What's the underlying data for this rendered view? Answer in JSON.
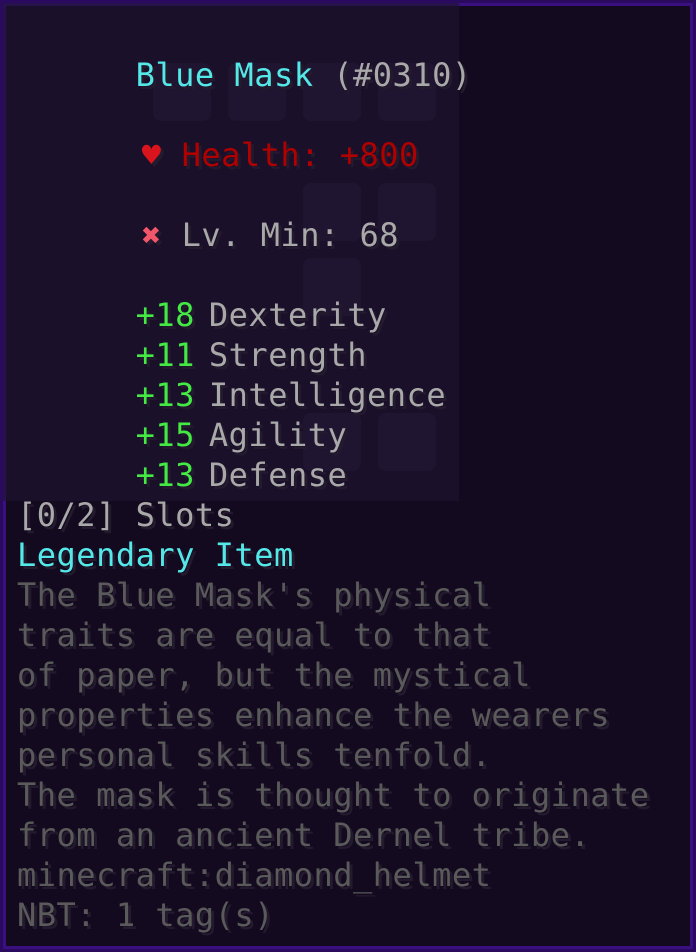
{
  "item": {
    "name": "Blue Mask",
    "id": "(#0310)",
    "health_label": "Health: +800",
    "level_label": "Lv. Min: 68",
    "stats": [
      {
        "value": "+18",
        "name": "Dexterity"
      },
      {
        "value": "+11",
        "name": "Strength"
      },
      {
        "value": "+13",
        "name": "Intelligence"
      },
      {
        "value": "+15",
        "name": "Agility"
      },
      {
        "value": "+13",
        "name": "Defense"
      }
    ],
    "slots": "[0/2] Slots",
    "rarity": "Legendary Item",
    "lore": [
      "The Blue Mask's physical",
      "traits are equal to that",
      "of paper, but the mystical",
      "properties enhance the wearers",
      "personal skills tenfold.",
      "The mask is thought to originate",
      "from an ancient Dernel tribe."
    ],
    "registry_id": "minecraft:diamond_helmet",
    "nbt": "NBT: 1 tag(s)"
  },
  "icons": {
    "health": "heart-icon",
    "level": "cross-icon"
  },
  "colors": {
    "name": "#55e8e8",
    "health": "#b00000",
    "stat_value": "#44ea44",
    "text": "#a9a9a9",
    "lore": "#5a5a5a",
    "border": "#2a0a5e",
    "background": "#130a1f"
  }
}
